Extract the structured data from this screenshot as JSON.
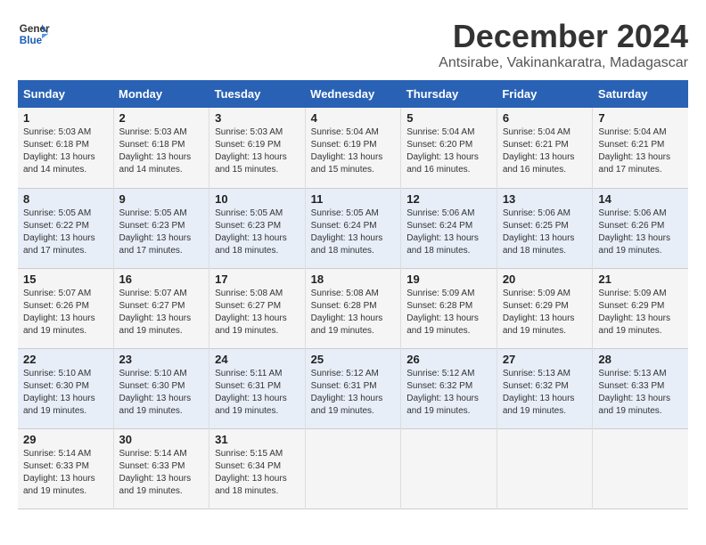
{
  "logo": {
    "line1": "General",
    "line2": "Blue"
  },
  "title": "December 2024",
  "location": "Antsirabe, Vakinankaratra, Madagascar",
  "days_of_week": [
    "Sunday",
    "Monday",
    "Tuesday",
    "Wednesday",
    "Thursday",
    "Friday",
    "Saturday"
  ],
  "weeks": [
    [
      {
        "day": "1",
        "info": "Sunrise: 5:03 AM\nSunset: 6:18 PM\nDaylight: 13 hours\nand 14 minutes."
      },
      {
        "day": "2",
        "info": "Sunrise: 5:03 AM\nSunset: 6:18 PM\nDaylight: 13 hours\nand 14 minutes."
      },
      {
        "day": "3",
        "info": "Sunrise: 5:03 AM\nSunset: 6:19 PM\nDaylight: 13 hours\nand 15 minutes."
      },
      {
        "day": "4",
        "info": "Sunrise: 5:04 AM\nSunset: 6:19 PM\nDaylight: 13 hours\nand 15 minutes."
      },
      {
        "day": "5",
        "info": "Sunrise: 5:04 AM\nSunset: 6:20 PM\nDaylight: 13 hours\nand 16 minutes."
      },
      {
        "day": "6",
        "info": "Sunrise: 5:04 AM\nSunset: 6:21 PM\nDaylight: 13 hours\nand 16 minutes."
      },
      {
        "day": "7",
        "info": "Sunrise: 5:04 AM\nSunset: 6:21 PM\nDaylight: 13 hours\nand 17 minutes."
      }
    ],
    [
      {
        "day": "8",
        "info": "Sunrise: 5:05 AM\nSunset: 6:22 PM\nDaylight: 13 hours\nand 17 minutes."
      },
      {
        "day": "9",
        "info": "Sunrise: 5:05 AM\nSunset: 6:23 PM\nDaylight: 13 hours\nand 17 minutes."
      },
      {
        "day": "10",
        "info": "Sunrise: 5:05 AM\nSunset: 6:23 PM\nDaylight: 13 hours\nand 18 minutes."
      },
      {
        "day": "11",
        "info": "Sunrise: 5:05 AM\nSunset: 6:24 PM\nDaylight: 13 hours\nand 18 minutes."
      },
      {
        "day": "12",
        "info": "Sunrise: 5:06 AM\nSunset: 6:24 PM\nDaylight: 13 hours\nand 18 minutes."
      },
      {
        "day": "13",
        "info": "Sunrise: 5:06 AM\nSunset: 6:25 PM\nDaylight: 13 hours\nand 18 minutes."
      },
      {
        "day": "14",
        "info": "Sunrise: 5:06 AM\nSunset: 6:26 PM\nDaylight: 13 hours\nand 19 minutes."
      }
    ],
    [
      {
        "day": "15",
        "info": "Sunrise: 5:07 AM\nSunset: 6:26 PM\nDaylight: 13 hours\nand 19 minutes."
      },
      {
        "day": "16",
        "info": "Sunrise: 5:07 AM\nSunset: 6:27 PM\nDaylight: 13 hours\nand 19 minutes."
      },
      {
        "day": "17",
        "info": "Sunrise: 5:08 AM\nSunset: 6:27 PM\nDaylight: 13 hours\nand 19 minutes."
      },
      {
        "day": "18",
        "info": "Sunrise: 5:08 AM\nSunset: 6:28 PM\nDaylight: 13 hours\nand 19 minutes."
      },
      {
        "day": "19",
        "info": "Sunrise: 5:09 AM\nSunset: 6:28 PM\nDaylight: 13 hours\nand 19 minutes."
      },
      {
        "day": "20",
        "info": "Sunrise: 5:09 AM\nSunset: 6:29 PM\nDaylight: 13 hours\nand 19 minutes."
      },
      {
        "day": "21",
        "info": "Sunrise: 5:09 AM\nSunset: 6:29 PM\nDaylight: 13 hours\nand 19 minutes."
      }
    ],
    [
      {
        "day": "22",
        "info": "Sunrise: 5:10 AM\nSunset: 6:30 PM\nDaylight: 13 hours\nand 19 minutes."
      },
      {
        "day": "23",
        "info": "Sunrise: 5:10 AM\nSunset: 6:30 PM\nDaylight: 13 hours\nand 19 minutes."
      },
      {
        "day": "24",
        "info": "Sunrise: 5:11 AM\nSunset: 6:31 PM\nDaylight: 13 hours\nand 19 minutes."
      },
      {
        "day": "25",
        "info": "Sunrise: 5:12 AM\nSunset: 6:31 PM\nDaylight: 13 hours\nand 19 minutes."
      },
      {
        "day": "26",
        "info": "Sunrise: 5:12 AM\nSunset: 6:32 PM\nDaylight: 13 hours\nand 19 minutes."
      },
      {
        "day": "27",
        "info": "Sunrise: 5:13 AM\nSunset: 6:32 PM\nDaylight: 13 hours\nand 19 minutes."
      },
      {
        "day": "28",
        "info": "Sunrise: 5:13 AM\nSunset: 6:33 PM\nDaylight: 13 hours\nand 19 minutes."
      }
    ],
    [
      {
        "day": "29",
        "info": "Sunrise: 5:14 AM\nSunset: 6:33 PM\nDaylight: 13 hours\nand 19 minutes."
      },
      {
        "day": "30",
        "info": "Sunrise: 5:14 AM\nSunset: 6:33 PM\nDaylight: 13 hours\nand 19 minutes."
      },
      {
        "day": "31",
        "info": "Sunrise: 5:15 AM\nSunset: 6:34 PM\nDaylight: 13 hours\nand 18 minutes."
      },
      {
        "day": "",
        "info": ""
      },
      {
        "day": "",
        "info": ""
      },
      {
        "day": "",
        "info": ""
      },
      {
        "day": "",
        "info": ""
      }
    ]
  ]
}
